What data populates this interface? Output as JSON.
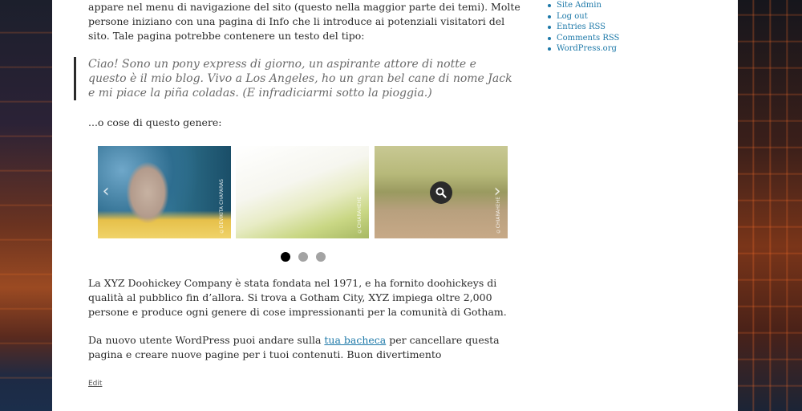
{
  "paragraphs": {
    "intro": "appare nel menu di navigazione del sito (questo nella maggior parte dei temi). Molte persone iniziano con una pagina di Info che li introduce ai potenziali visitatori del sito. Tale pagina potrebbe contenere un testo del tipo:",
    "quote": "Ciao! Sono un pony express di giorno, un aspirante attore di notte e questo è il mio blog. Vivo a Los Angeles, ho un gran bel cane di nome Jack e mi piace la piña coladas. (E infradiciarmi sotto la pioggia.)",
    "or_like": "...o cose di questo genere:",
    "company": "La XYZ Doohickey Company è stata fondata nel 1971, e ha fornito doohickeys di qualità al pubblico fin d’allora. Si trova a Gotham City, XYZ impiega oltre 2,000 persone e produce ogni genere di cose impressionanti per la comunità di Gotham.",
    "new_user_before": "Da nuovo utente WordPress puoi andare sulla ",
    "new_user_link": "tua bacheca",
    "new_user_after": " per cancellare questa pagina e creare nuove pagine per i tuoi contenuti. Buon divertimento"
  },
  "edit_label": "Edit",
  "gallery": {
    "prev_icon": "‹",
    "next_icon": "›",
    "credits": [
      "©DEVIKITA CHAPARAS",
      "©CHIARAHEHE",
      "©CHIARAHEHE"
    ],
    "active_dot": 1,
    "dot_count": 3
  },
  "sidebar": {
    "links": [
      "Site Admin",
      "Log out",
      "Entries RSS",
      "Comments RSS",
      "WordPress.org"
    ]
  },
  "colors": {
    "link": "#1c78a8",
    "text": "#2b2b2b",
    "quote": "#6a6a6a"
  }
}
